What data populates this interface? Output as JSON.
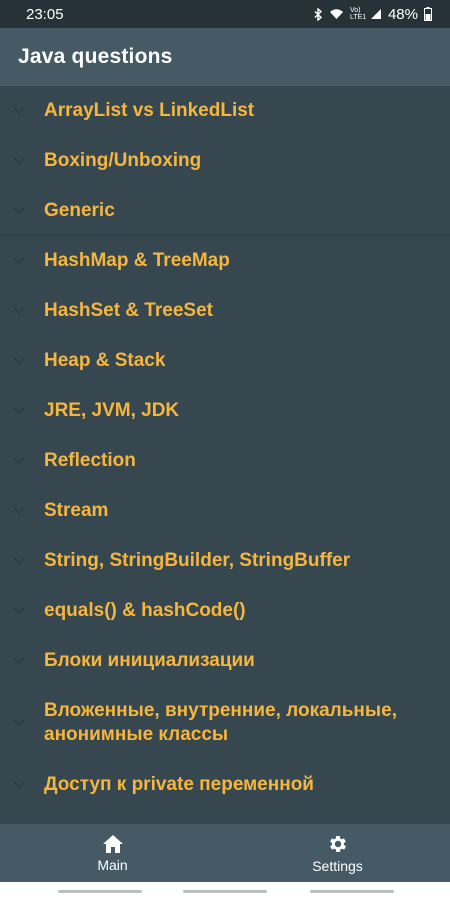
{
  "status_bar": {
    "time": "23:05",
    "network_label": "Vo) LTE1",
    "battery": "48%"
  },
  "app_bar": {
    "title": "Java questions"
  },
  "questions": [
    "ArrayList vs LinkedList",
    "Boxing/Unboxing",
    "Generic",
    "HashMap & TreeMap",
    "HashSet & TreeSet",
    "Heap & Stack",
    "JRE, JVM, JDK",
    "Reflection",
    "Stream",
    "String, StringBuilder, StringBuffer",
    "equals() & hashCode()",
    "Блоки инициализации",
    "Вложенные, внутренние, локальные, анонимные классы",
    "Доступ к private переменной"
  ],
  "bottom_nav": {
    "main_label": "Main",
    "settings_label": "Settings"
  },
  "icons": {
    "chevron": "chevron-down-icon",
    "main": "home-icon",
    "settings": "gear-icon"
  },
  "colors": {
    "background": "#37474f",
    "bar": "#455a64",
    "accent_text": "#f4b63f",
    "status_bar": "#263238"
  }
}
